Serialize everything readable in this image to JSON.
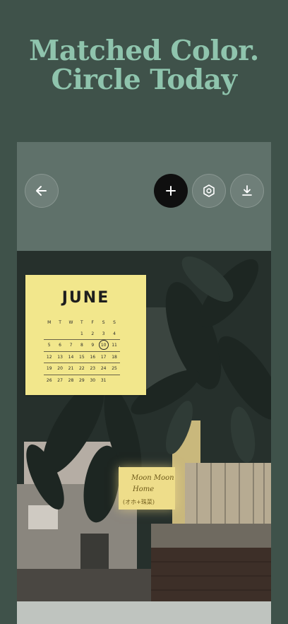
{
  "headline": {
    "line1": "Matched Color.",
    "line2": "Circle Today"
  },
  "toolbar": {
    "back_icon": "arrow-left-icon",
    "add_icon": "plus-icon",
    "settings_icon": "hexagon-settings-icon",
    "download_icon": "download-icon"
  },
  "calendar": {
    "month": "JUNE",
    "weekdays": [
      "M",
      "T",
      "W",
      "T",
      "F",
      "S",
      "S"
    ],
    "weeks": [
      [
        "",
        "",
        "",
        "1",
        "2",
        "3",
        "4"
      ],
      [
        "5",
        "6",
        "7",
        "8",
        "9",
        "10",
        "11"
      ],
      [
        "12",
        "13",
        "14",
        "15",
        "16",
        "17",
        "18"
      ],
      [
        "19",
        "20",
        "21",
        "22",
        "23",
        "24",
        "25"
      ],
      [
        "26",
        "27",
        "28",
        "29",
        "30",
        "31",
        ""
      ]
    ],
    "today": "10"
  },
  "sign": {
    "line1": "Moon Moon",
    "line2": "Home",
    "line3": "(オホ+珠菜)"
  },
  "colors": {
    "background": "#3f524a",
    "headline": "#8fc4ad",
    "panel": "#5f716a",
    "note": "#f2e78c"
  }
}
